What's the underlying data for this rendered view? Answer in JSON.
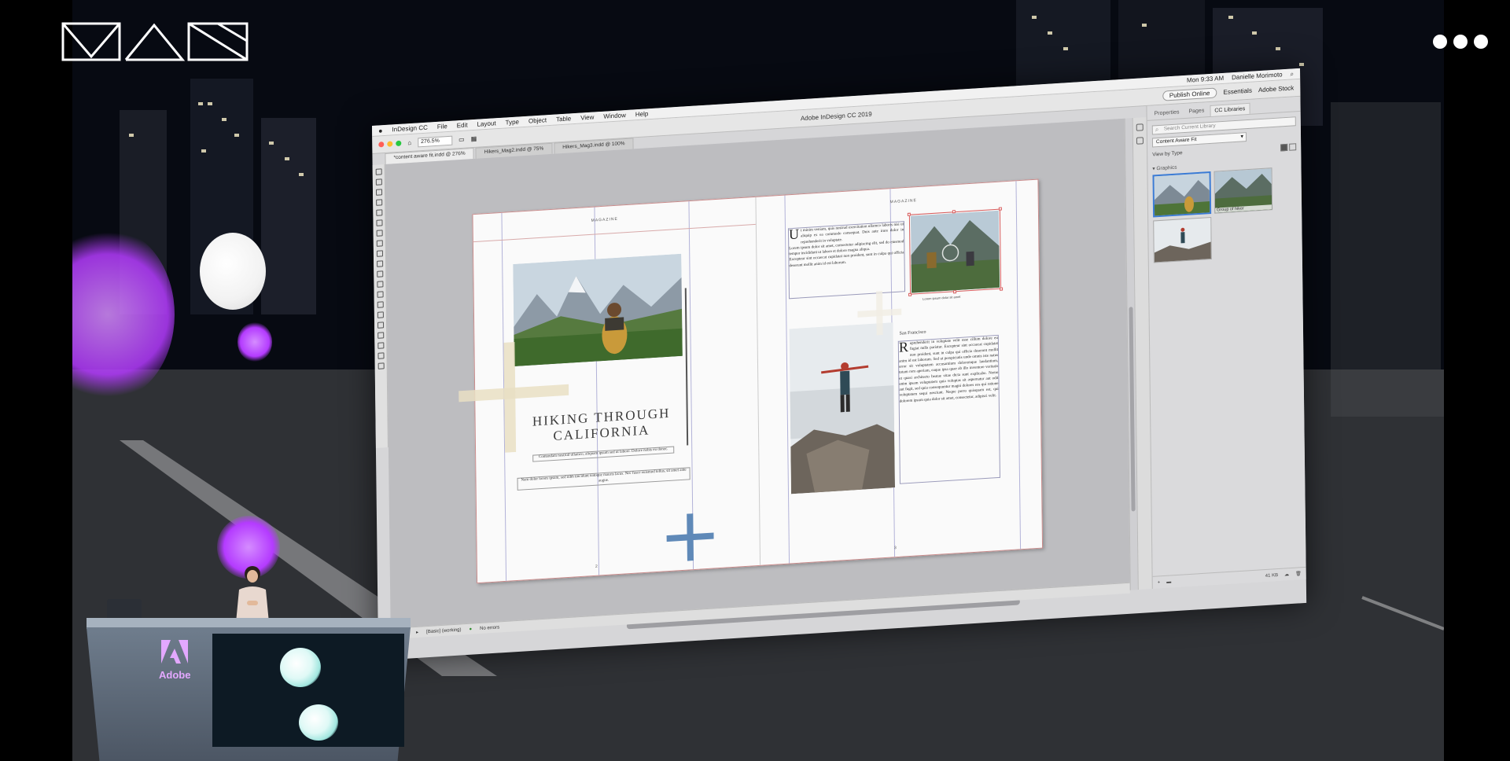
{
  "event_logo": {
    "text": "MAX"
  },
  "colors": {
    "accent_purple": "#b43bff",
    "selection_red": "#d65a5a",
    "selection_blue": "#3a7bd5",
    "status_green": "#2b8a2b"
  },
  "mac_menu": {
    "apple": "",
    "right": {
      "clock": "Mon 9:33 AM",
      "user": "Danielle Morimoto",
      "search_placeholder": "Adobe Stock"
    }
  },
  "app": {
    "title": "Adobe InDesign CC 2019",
    "menu": [
      "InDesign CC",
      "File",
      "Edit",
      "Layout",
      "Type",
      "Object",
      "Table",
      "View",
      "Window",
      "Help"
    ],
    "zoom": "276.5%",
    "publish_online": "Publish Online",
    "workspace": "Essentials"
  },
  "doc_tabs": [
    {
      "label": "*content aware fit.indd @ 276%",
      "active": true
    },
    {
      "label": "Hikers_Mag2.indd @ 75%",
      "active": false
    },
    {
      "label": "Hikers_Mag3.indd @ 100%",
      "active": false
    }
  ],
  "spread": {
    "running_head_left": "MAGAZINE",
    "running_head_right": "MAGAZINE",
    "headline_line1": "HIKING THROUGH",
    "headline_line2": "CALIFORNIA",
    "subhead": "Contendam nostrud ullamco, aliquam ipsum sed ut labore. Dolore nobis eu donec.",
    "intro": "Nam dolor lorem ipsum, sed nibh tincidunt natoque mauris lacus. Nec fusce euismod tellus, sit amet ante augue.",
    "left_page_number": "2",
    "right_page_number": "3",
    "right_top_dropcap": "U",
    "right_top_text_1": "t minim veniam, quis nostrud exercitation ullamco laboris nisi ut aliquip ex ea commodo consequat. Duis aute irure dolor in reprehenderit in voluptate.",
    "right_top_text_2": "Lorem ipsum dolor sit amet, consectetur adipiscing elit, sed do eiusmod tempor incididunt ut labore et dolore magna aliqua.",
    "right_top_text_3": "Excepteur sint occaecat cupidatat non proident, sunt in culpa qui officia deserunt mollit anim id est laborum.",
    "photo_caption": "Lorem ipsum dolor sit amet",
    "kicker": "San Francisco",
    "body_dropcap": "R",
    "body_text": "eprehenderit in voluptate velit esse cillum dolore eu fugiat nulla pariatur. Excepteur sint occaecat cupidatat non proident, sunt in culpa qui officia deserunt mollit anim id est laborum. Sed ut perspiciatis unde omnis iste natus error sit voluptatem accusantium doloremque laudantium, totam rem aperiam, eaque ipsa quae ab illo inventore veritatis et quasi architecto beatae vitae dicta sunt explicabo. Nemo enim ipsam voluptatem quia voluptas sit aspernatur aut odit aut fugit, sed quia consequuntur magni dolores eos qui ratione voluptatem sequi nesciunt. Neque porro quisquam est, qui dolorem ipsum quia dolor sit amet, consectetur, adipisci velit."
  },
  "status_bar": {
    "page": "1",
    "style": "[Basic] (working)",
    "errors": "No errors"
  },
  "libraries_panel": {
    "tabs": [
      "Properties",
      "Pages",
      "CC Libraries"
    ],
    "active_tab": "CC Libraries",
    "search_placeholder": "Search Current Library",
    "library": "Content Aware Fit",
    "view_by": "View by Type",
    "section": "Graphics",
    "assets": [
      {
        "label": ""
      },
      {
        "label": "Group of hiker"
      },
      {
        "label": ""
      }
    ],
    "footer_size": "41 KB"
  }
}
